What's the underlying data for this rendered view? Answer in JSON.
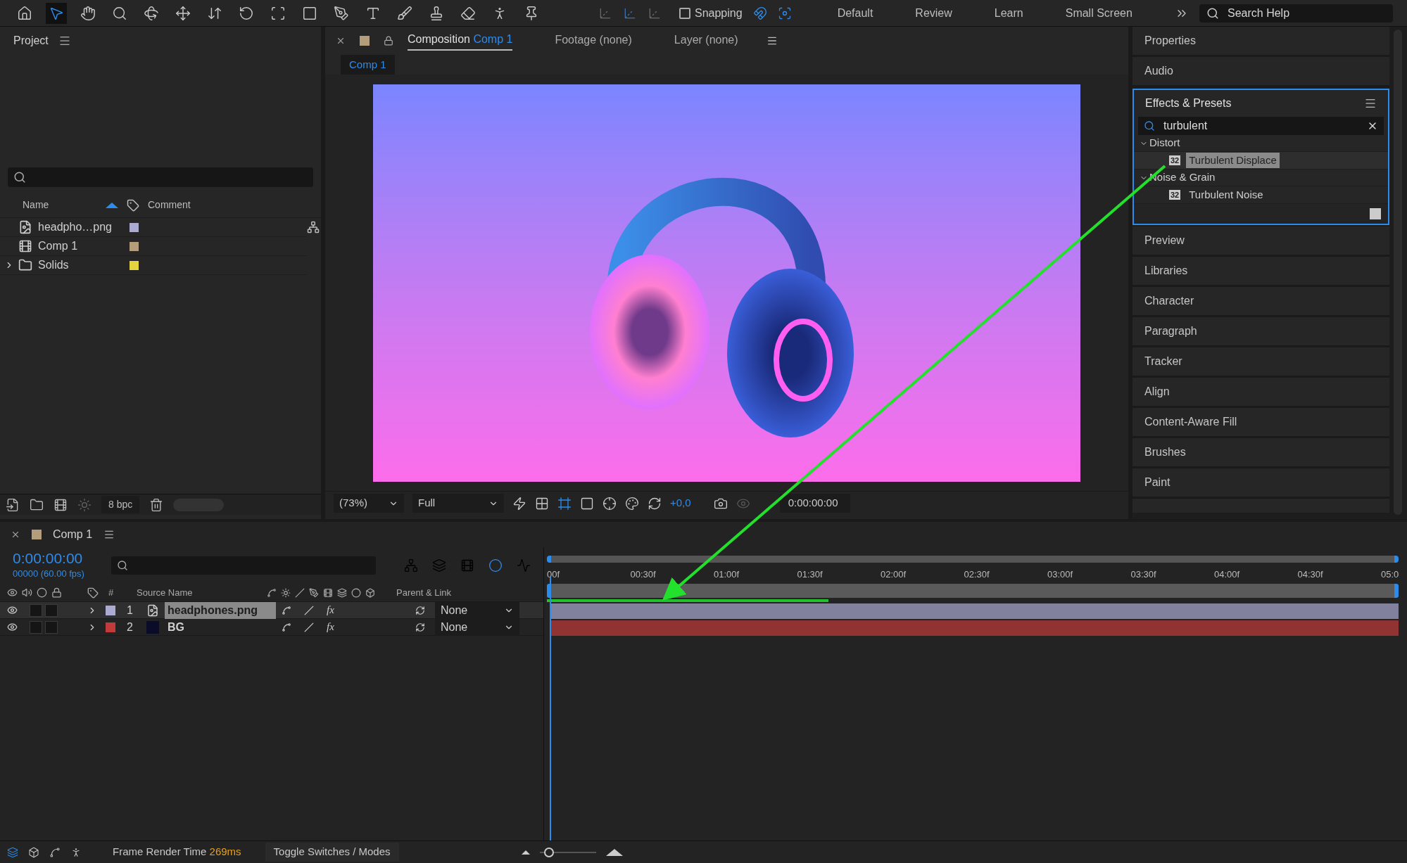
{
  "toolbar": {
    "snapping": {
      "label": "Snapping",
      "checked": false
    },
    "workspaces": [
      {
        "label": "Default",
        "selected": false
      },
      {
        "label": "Review",
        "selected": false
      },
      {
        "label": "Learn",
        "selected": false
      },
      {
        "label": "Small Screen",
        "selected": false
      }
    ],
    "search": {
      "placeholder": "Search Help"
    }
  },
  "project": {
    "title": "Project",
    "columns": [
      "Name",
      "Comment"
    ],
    "items": [
      {
        "name": "headpho…png",
        "kind": "footage",
        "color": "#aaaad2"
      },
      {
        "name": "Comp 1",
        "kind": "composition",
        "color": "#b39d7b"
      },
      {
        "name": "Solids",
        "kind": "folder",
        "color": "#e3d440",
        "expanded": false
      }
    ],
    "bit_depth": "8 bpc"
  },
  "viewer": {
    "tabs": [
      {
        "label": "Composition",
        "target": "Comp 1",
        "selected": true
      },
      {
        "label": "Footage (none)",
        "selected": false
      },
      {
        "label": "Layer (none)",
        "selected": false
      }
    ],
    "comp_tab": "Comp 1",
    "zoom": "(73%)",
    "resolution": "Full",
    "exposure": "+0,0",
    "timecode": "0:00:00:00"
  },
  "panels_top": [
    "Properties",
    "Audio"
  ],
  "effects": {
    "title": "Effects & Presets",
    "search": "turbulent",
    "groups": [
      {
        "name": "Distort",
        "expanded": true,
        "children": [
          {
            "name": "Turbulent Displace",
            "badge": "32",
            "selected": true
          }
        ]
      },
      {
        "name": "Noise & Grain",
        "expanded": true,
        "children": [
          {
            "name": "Turbulent Noise",
            "badge": "32",
            "selected": false
          }
        ]
      }
    ]
  },
  "panels_bottom": [
    "Preview",
    "Libraries",
    "Character",
    "Paragraph",
    "Tracker",
    "Align",
    "Content-Aware Fill",
    "Brushes",
    "Paint"
  ],
  "timeline": {
    "title": "Comp 1",
    "color": "#b39d7b",
    "timecode": "0:00:00:00",
    "frame_info": "00000 (60.00 fps)",
    "columns": [
      "#",
      "Source Name",
      "Parent & Link"
    ],
    "ruler": [
      "00f",
      "00:30f",
      "01:00f",
      "01:30f",
      "02:00f",
      "02:30f",
      "03:00f",
      "03:30f",
      "04:00f",
      "04:30f",
      "05:0"
    ],
    "layers": [
      {
        "number": "1",
        "name": "headphones.png",
        "kind": "footage",
        "color": "#aaaad2",
        "selected": true,
        "visible": true,
        "parent": "None",
        "solo": false,
        "locked": false,
        "fx": {
          "label": "fx",
          "on": true
        }
      },
      {
        "number": "2",
        "name": "BG",
        "kind": "solid",
        "color": "#c23a3a",
        "selected": false,
        "visible": true,
        "parent": "None",
        "solo": false,
        "locked": false,
        "fx": {
          "label": "fx",
          "on": true
        }
      }
    ]
  },
  "status": {
    "label": "Frame Render Time",
    "value": "269ms",
    "toggle": "Toggle Switches / Modes",
    "zoom": {
      "level": 0.1
    }
  }
}
